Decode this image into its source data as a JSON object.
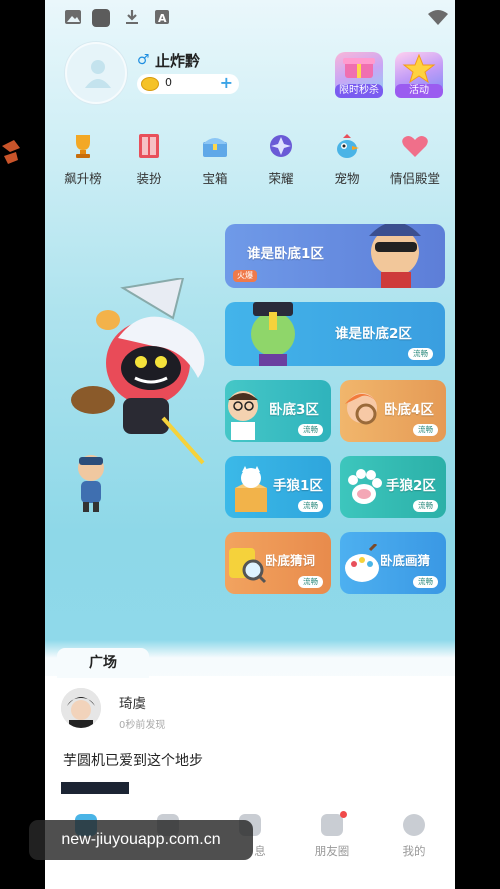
{
  "statusbar": {
    "icons": [
      "image-icon",
      "app-icon",
      "download-icon",
      "text-icon",
      "wifi-icon"
    ]
  },
  "profile": {
    "gender_symbol": "♂",
    "username": "止炸黔",
    "coins": "0",
    "coin_add": "+"
  },
  "promos": [
    {
      "label": "限时秒杀",
      "icon": "gift-box-icon"
    },
    {
      "label": "活动",
      "icon": "star-icon"
    }
  ],
  "nav": [
    {
      "label": "飙升榜",
      "icon": "trophy-icon"
    },
    {
      "label": "装扮",
      "icon": "wardrobe-icon"
    },
    {
      "label": "宝箱",
      "icon": "chest-icon"
    },
    {
      "label": "荣耀",
      "icon": "medal-icon"
    },
    {
      "label": "宠物",
      "icon": "pet-bird-icon"
    },
    {
      "label": "情侣殿堂",
      "icon": "heart-icon"
    }
  ],
  "rooms": [
    {
      "title": "谁是卧底1区",
      "badge": "火爆"
    },
    {
      "title": "谁是卧底2区",
      "badge": "流畅"
    },
    {
      "title": "卧底3区",
      "badge": "流畅"
    },
    {
      "title": "卧底4区",
      "badge": "流畅"
    },
    {
      "title": "手狼1区",
      "badge": "流畅"
    },
    {
      "title": "手狼2区",
      "badge": "流畅"
    },
    {
      "title": "卧底猜词",
      "badge": "流畅"
    },
    {
      "title": "卧底画猜",
      "badge": "流畅"
    }
  ],
  "plaza": {
    "tab_label": "广场",
    "post": {
      "author": "琦虞",
      "time": "0秒前发现",
      "text": "芋圆机已爱到这个地步"
    }
  },
  "tabbar": [
    {
      "label": "",
      "icon": "home-icon"
    },
    {
      "label": "",
      "icon": "game-icon"
    },
    {
      "label": "息",
      "icon": "message-icon"
    },
    {
      "label": "朋友圈",
      "icon": "moments-icon"
    },
    {
      "label": "我的",
      "icon": "profile-icon"
    }
  ],
  "watermark": "new-jiuyouapp.com.cn",
  "colors": {
    "accent": "#3ba3e6",
    "sky_top": "#eaf7fb",
    "sky_bottom": "#8ed8e8",
    "badge_fluent": "#2c8a7e",
    "badge_hot": "#f07a4b"
  }
}
